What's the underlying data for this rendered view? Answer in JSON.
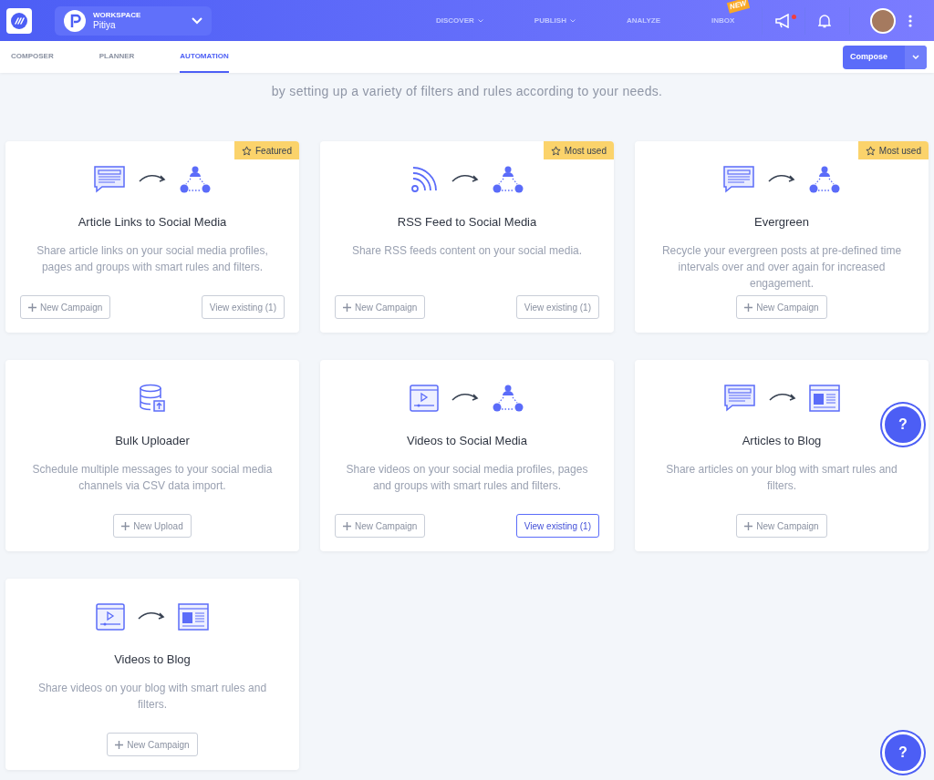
{
  "top_bar": {
    "workspace": {
      "label": "WORKSPACE",
      "name": "Pitiya"
    },
    "nav": [
      {
        "label": "DISCOVER",
        "has_menu": true
      },
      {
        "label": "PUBLISH",
        "has_menu": true
      },
      {
        "label": "ANALYZE",
        "has_menu": false
      },
      {
        "label": "INBOX",
        "has_menu": false,
        "badge": "NEW"
      }
    ],
    "notification_dot": true
  },
  "sub_nav": {
    "tabs": [
      {
        "label": "COMPOSER",
        "selected": false
      },
      {
        "label": "PLANNER",
        "selected": false
      },
      {
        "label": "AUTOMATION",
        "selected": true
      }
    ],
    "compose_button": "Compose"
  },
  "intro": "by setting up a variety of filters and rules according to your needs.",
  "cards": [
    {
      "icons": [
        {
          "kind": "article"
        },
        {
          "kind": "arrow"
        },
        {
          "kind": "social"
        }
      ],
      "badge": "Featured",
      "title": "Article Links to Social Media",
      "description": "Share article links on your social media profiles, pages and groups with smart rules and filters.",
      "buttons": [
        {
          "kind": "new",
          "label": "New Campaign"
        },
        {
          "kind": "view",
          "label": "View existing (1)",
          "highlighted": false
        }
      ]
    },
    {
      "icons": [
        {
          "kind": "rss"
        },
        {
          "kind": "arrow"
        },
        {
          "kind": "social"
        }
      ],
      "badge": "Most used",
      "title": "RSS Feed to Social Media",
      "description": "Share RSS feeds content on your social media.",
      "buttons": [
        {
          "kind": "new",
          "label": "New Campaign"
        },
        {
          "kind": "view",
          "label": "View existing (1)",
          "highlighted": false
        }
      ]
    },
    {
      "icons": [
        {
          "kind": "article"
        },
        {
          "kind": "arrow"
        },
        {
          "kind": "social"
        }
      ],
      "badge": "Most used",
      "title": "Evergreen",
      "description": "Recycle your evergreen posts at pre-defined time intervals over and over again for increased engagement.",
      "buttons": [
        {
          "kind": "new",
          "label": "New Campaign"
        }
      ]
    },
    {
      "icons": [
        {
          "kind": "database"
        }
      ],
      "title": "Bulk Uploader",
      "description": "Schedule multiple messages to your social media channels via CSV data import.",
      "buttons": [
        {
          "kind": "new",
          "label": "New Upload"
        }
      ]
    },
    {
      "icons": [
        {
          "kind": "video"
        },
        {
          "kind": "arrow"
        },
        {
          "kind": "social"
        }
      ],
      "title": "Videos to Social Media",
      "description": "Share videos on your social media profiles, pages and groups with smart rules and filters.",
      "buttons": [
        {
          "kind": "new",
          "label": "New Campaign"
        },
        {
          "kind": "view",
          "label": "View existing (1)",
          "highlighted": true
        }
      ]
    },
    {
      "icons": [
        {
          "kind": "article"
        },
        {
          "kind": "arrow"
        },
        {
          "kind": "blog"
        }
      ],
      "title": "Articles to Blog",
      "description": "Share articles on your blog with smart rules and filters.",
      "buttons": [
        {
          "kind": "new",
          "label": "New Campaign"
        }
      ]
    },
    {
      "icons": [
        {
          "kind": "video"
        },
        {
          "kind": "arrow"
        },
        {
          "kind": "blog"
        }
      ],
      "title": "Videos to Blog",
      "description": "Share videos on your blog with smart rules and filters.",
      "buttons": [
        {
          "kind": "new",
          "label": "New Campaign"
        }
      ]
    }
  ],
  "help_buttons": [
    "?",
    "?"
  ]
}
